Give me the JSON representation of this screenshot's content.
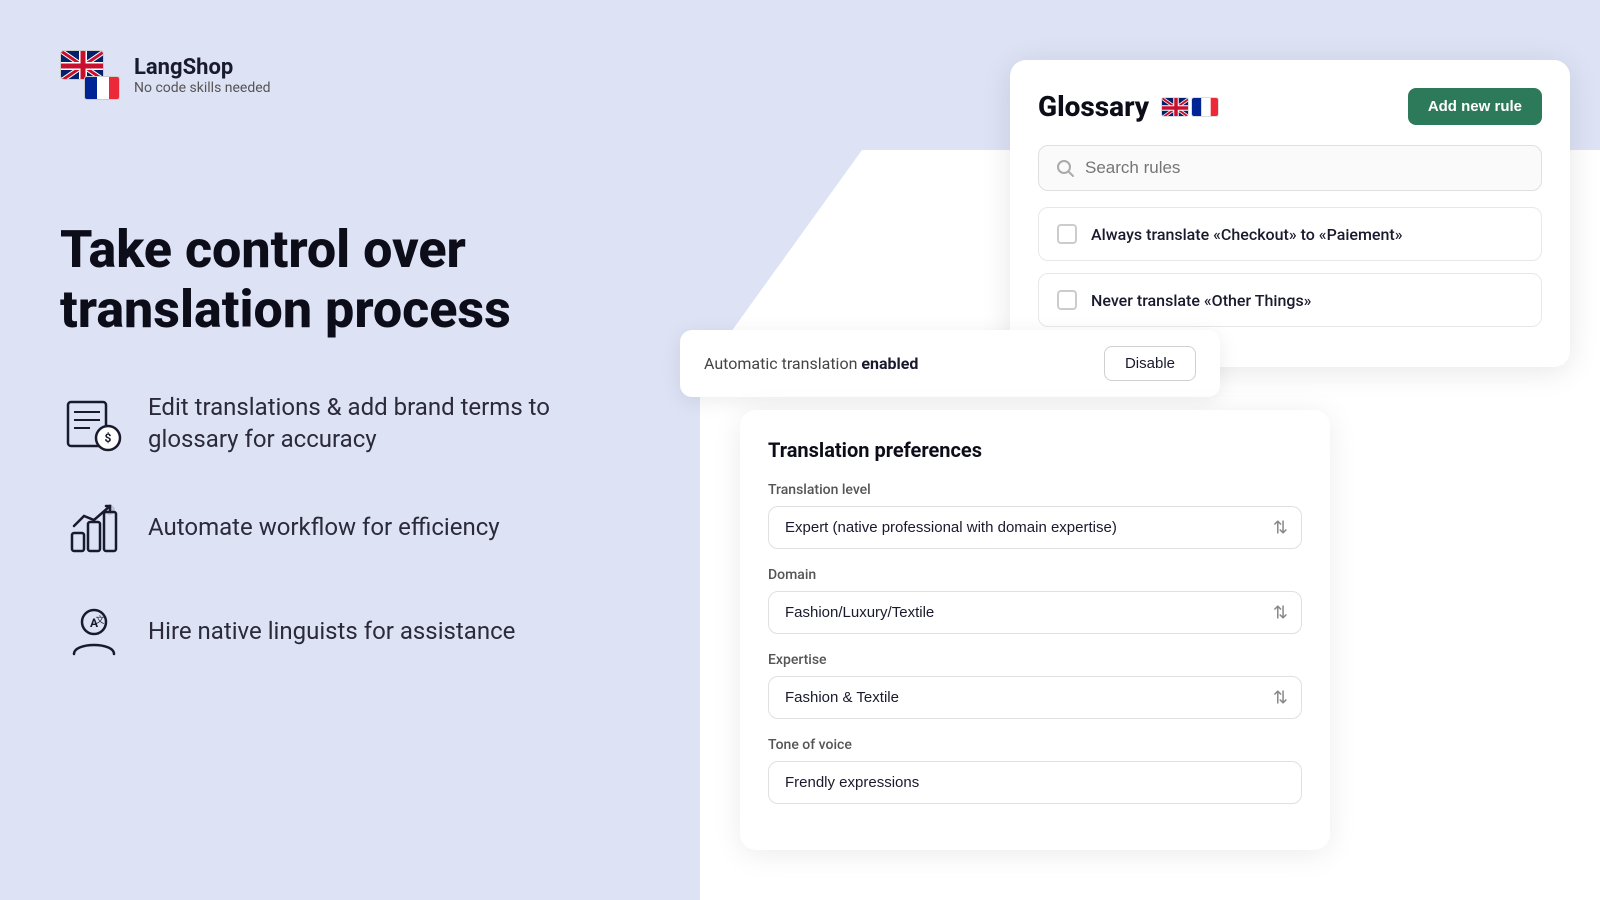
{
  "logo": {
    "name": "LangShop",
    "tagline": "No code skills needed"
  },
  "hero": {
    "title": "Take control over translation process",
    "features": [
      {
        "id": "edit",
        "text": "Edit translations & add brand terms to glossary for accuracy"
      },
      {
        "id": "automate",
        "text": "Automate workflow for efficiency"
      },
      {
        "id": "hire",
        "text": "Hire native linguists for assistance"
      }
    ]
  },
  "glossary": {
    "title": "Glossary",
    "add_button": "Add new rule",
    "search_placeholder": "Search rules",
    "rules": [
      {
        "id": "rule1",
        "text": "Always translate «Checkout» to «Paiement»"
      },
      {
        "id": "rule2",
        "text": "Never translate «Other Things»"
      }
    ]
  },
  "auto_translation": {
    "label": "Automatic translation",
    "status": "enabled",
    "disable_button": "Disable"
  },
  "translation_prefs": {
    "section_title": "Translation preferences",
    "level_label": "Translation level",
    "level_value": "Expert (native professional with domain expertise)",
    "domain_label": "Domain",
    "domain_value": "Fashion/Luxury/Textile",
    "expertise_label": "Expertise",
    "expertise_value": "Fashion & Textile",
    "tone_label": "Tone of voice",
    "tone_value": "Frendly expressions"
  }
}
